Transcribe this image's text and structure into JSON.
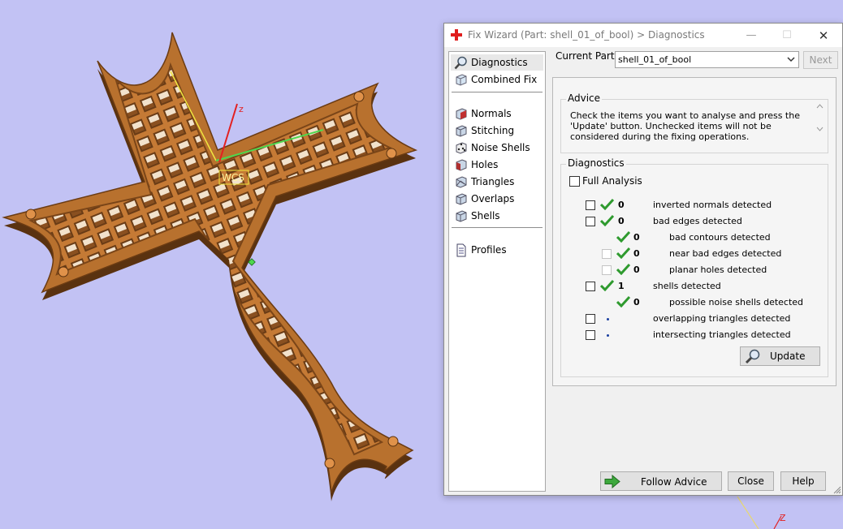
{
  "viewport": {
    "axis_label_z": "z",
    "axis_label_wcs": "WCS",
    "corner_axis_z": "Z"
  },
  "window": {
    "title": "Fix Wizard (Part: shell_01_of_bool) > Diagnostics",
    "icon": "red-cross-icon",
    "minimize_glyph": "—",
    "maximize_glyph": "☐",
    "close_glyph": "✕"
  },
  "nav": {
    "items": [
      {
        "label": "Diagnostics",
        "icon": "magnifier-icon"
      },
      {
        "label": "Combined Fix",
        "icon": "cube-icon"
      },
      {
        "label": "Normals",
        "icon": "cube-icon"
      },
      {
        "label": "Stitching",
        "icon": "cube-icon"
      },
      {
        "label": "Noise Shells",
        "icon": "dice-icon"
      },
      {
        "label": "Holes",
        "icon": "cube-icon"
      },
      {
        "label": "Triangles",
        "icon": "cube-icon"
      },
      {
        "label": "Overlaps",
        "icon": "cube-icon"
      },
      {
        "label": "Shells",
        "icon": "cube-icon"
      },
      {
        "label": "Profiles",
        "icon": "document-icon"
      }
    ]
  },
  "header": {
    "current_part_label": "Current Part:",
    "current_part_value": "shell_01_of_bool",
    "next_label": "Next"
  },
  "advice": {
    "title": "Advice",
    "text": "Check the items you want to analyse and press the 'Update' button. Unchecked items will not be considered during the fixing operations."
  },
  "diagnostics": {
    "title": "Diagnostics",
    "full_analysis_label": "Full Analysis",
    "rows": [
      {
        "count": "0",
        "label": "inverted normals detected",
        "status": "ok"
      },
      {
        "count": "0",
        "label": "bad edges detected",
        "status": "ok"
      },
      {
        "count": "0",
        "label": "bad contours detected",
        "status": "ok"
      },
      {
        "count": "0",
        "label": "near bad edges detected",
        "status": "ok"
      },
      {
        "count": "0",
        "label": "planar holes detected",
        "status": "ok"
      },
      {
        "count": "1",
        "label": "shells detected",
        "status": "ok"
      },
      {
        "count": "0",
        "label": "possible noise shells detected",
        "status": "ok"
      },
      {
        "count": "",
        "label": "overlapping triangles detected",
        "status": "pending"
      },
      {
        "count": "",
        "label": "intersecting triangles detected",
        "status": "pending"
      }
    ],
    "update_label": "Update"
  },
  "footer": {
    "follow_advice_label": "Follow Advice",
    "close_label": "Close",
    "help_label": "Help"
  },
  "colors": {
    "viewport_bg": "#c2c2f4",
    "part_orange": "#b8712e",
    "check_green": "#2e9a2e"
  }
}
